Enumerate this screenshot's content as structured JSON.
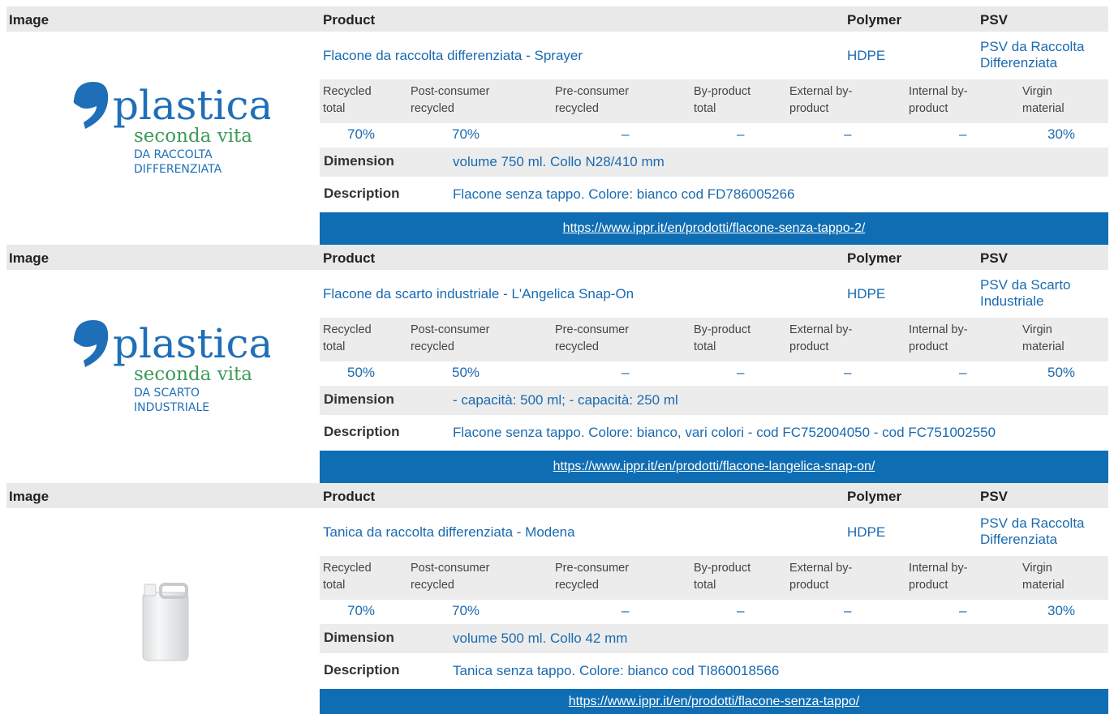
{
  "header": {
    "image": "Image",
    "product": "Product",
    "polymer": "Polymer",
    "psv": "PSV"
  },
  "labels": {
    "recycled_total": "Recycled total",
    "post_consumer": "Post-consumer recycled",
    "pre_consumer": "Pre-consumer recycled",
    "by_product": "By-product total",
    "external": "External by-product",
    "internal": "Internal by-product",
    "virgin": "Virgin material",
    "dimension": "Dimension",
    "description": "Description"
  },
  "logos": {
    "p0": {
      "word": "plastica",
      "sub": "seconda vita",
      "l1": "DA RACCOLTA",
      "l2": "DIFFERENZIATA"
    },
    "p1": {
      "word": "plastica",
      "sub": "seconda vita",
      "l1": "DA SCARTO",
      "l2": "INDUSTRIALE"
    }
  },
  "products": [
    {
      "name": "Flacone da raccolta differenziata - Sprayer",
      "polymer": "HDPE",
      "psv": "PSV da Raccolta Differenziata",
      "values": {
        "recycled_total": "70%",
        "post_consumer": "70%",
        "pre_consumer": "–",
        "by_product": "–",
        "external": "–",
        "internal": "–",
        "virgin": "30%"
      },
      "dimension": "volume 750 ml. Collo N28/410 mm",
      "description": "Flacone senza tappo. Colore: bianco cod FD786005266",
      "link": "https://www.ippr.it/en/prodotti/flacone-senza-tappo-2/"
    },
    {
      "name": "Flacone da scarto industriale - L'Angelica Snap-On",
      "polymer": "HDPE",
      "psv": "PSV da Scarto Industriale",
      "values": {
        "recycled_total": "50%",
        "post_consumer": "50%",
        "pre_consumer": "–",
        "by_product": "–",
        "external": "–",
        "internal": "–",
        "virgin": "50%"
      },
      "dimension": "- capacità: 500 ml; - capacità: 250 ml",
      "description": "Flacone senza tappo. Colore: bianco, vari colori - cod FC752004050 - cod FC751002550",
      "link": "https://www.ippr.it/en/prodotti/flacone-langelica-snap-on/"
    },
    {
      "name": "Tanica da raccolta differenziata - Modena",
      "polymer": "HDPE",
      "psv": "PSV da Raccolta Differenziata",
      "values": {
        "recycled_total": "70%",
        "post_consumer": "70%",
        "pre_consumer": "–",
        "by_product": "–",
        "external": "–",
        "internal": "–",
        "virgin": "30%"
      },
      "dimension": "volume 500 ml. Collo 42 mm",
      "description": "Tanica senza tappo. Colore: bianco cod TI860018566",
      "link": "https://www.ippr.it/en/prodotti/flacone-senza-tappo/"
    }
  ],
  "colors": {
    "link_text": "#1a6ab0",
    "link_bar": "#0f6db3",
    "logo_blue": "#1f6fb8",
    "logo_green": "#3d9a5a"
  }
}
